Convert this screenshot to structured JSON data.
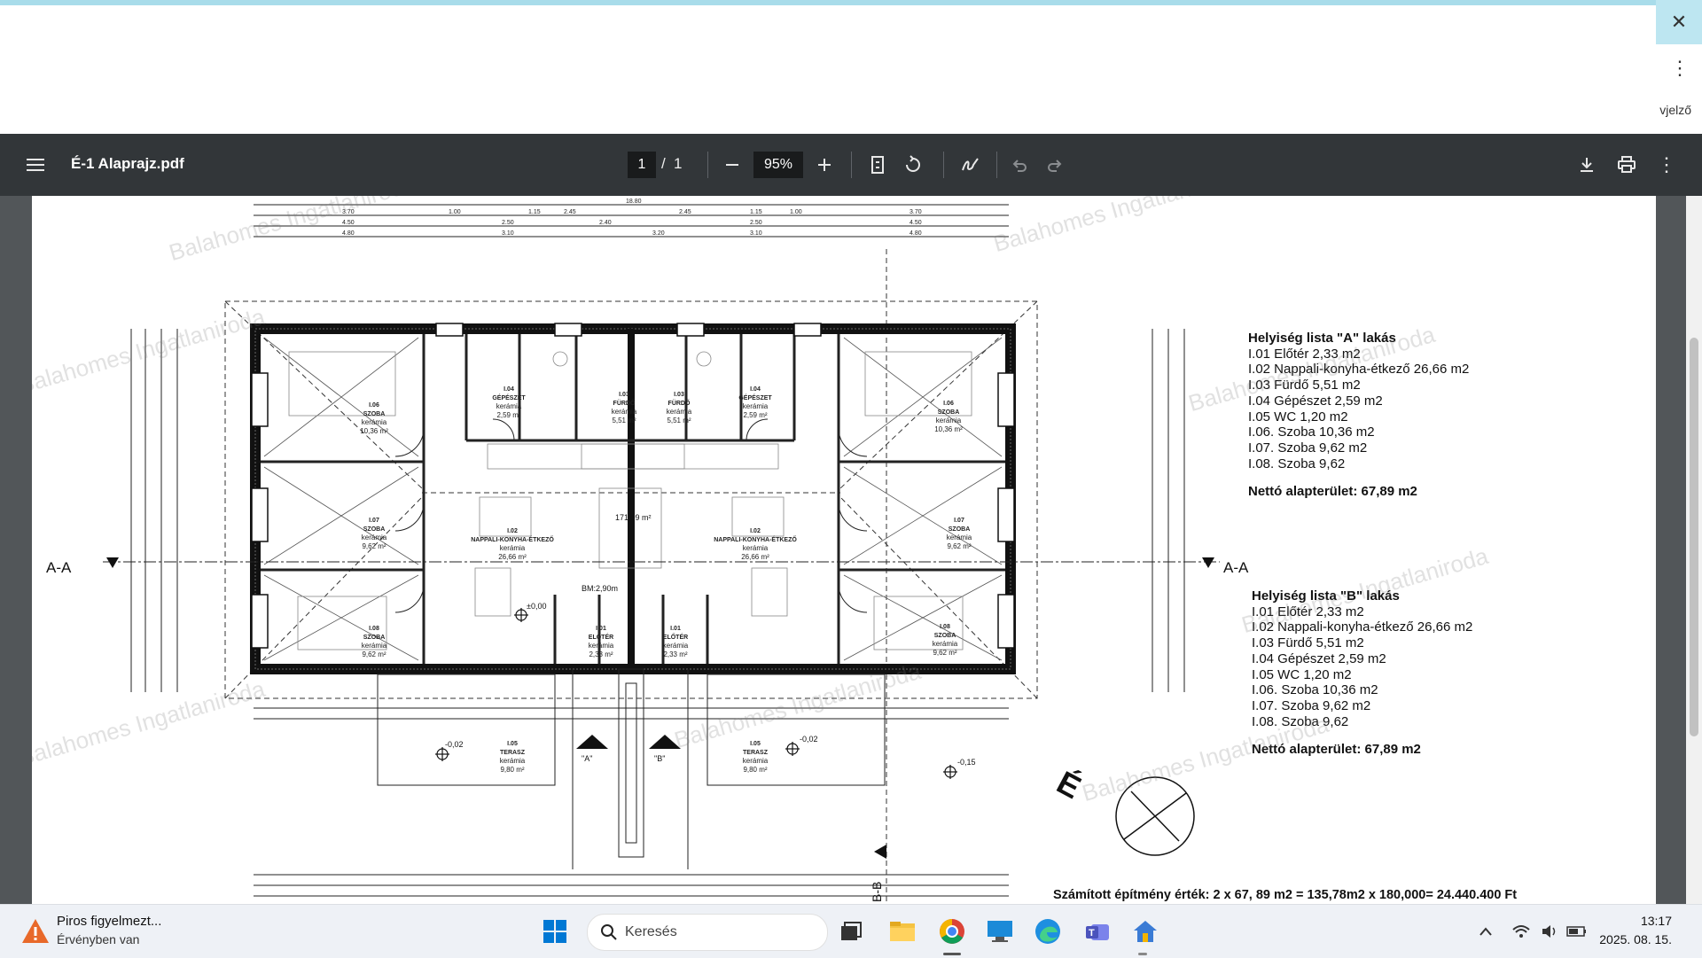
{
  "browser": {
    "menu_label": "⋮",
    "close_label": "✕",
    "side_text": "vjelző"
  },
  "toolbar": {
    "title": "É-1 Alaprajz.pdf",
    "page_current": "1",
    "page_sep": "/",
    "page_total": "1",
    "zoom": "95%",
    "icons": [
      "menu-icon",
      "zoom-out-icon",
      "zoom-in-icon",
      "fit-page-icon",
      "rotate-icon",
      "draw-icon",
      "undo-icon",
      "redo-icon",
      "download-icon",
      "print-icon",
      "more-icon"
    ]
  },
  "drawing": {
    "section_left": "A-A",
    "section_right": "A-A",
    "section_bottom": "B-B",
    "north_label": "É",
    "center_label": "BM:2,90m",
    "level_0": "±0,00",
    "level_1": "-0,02",
    "level_2": "-0,02",
    "level_3": "-0,15",
    "entry_a": "\"A\"",
    "entry_b": "\"B\"",
    "area_center": "171,09 m²",
    "rooms": [
      {
        "code": "I.06",
        "name": "SZOBA",
        "mat": "kerámia",
        "area": "10,36 m²"
      },
      {
        "code": "I.07",
        "name": "SZOBA",
        "mat": "kerámia",
        "area": "9,62 m²"
      },
      {
        "code": "I.08",
        "name": "SZOBA",
        "mat": "kerámia",
        "area": "9,62 m²"
      },
      {
        "code": "I.02",
        "name": "NAPPALI-KONYHA-ÉTKEZŐ",
        "mat": "kerámia",
        "area": "26,66 m²"
      },
      {
        "code": "I.02",
        "name": "NAPPALI-KONYHA-ÉTKEZŐ",
        "mat": "kerámia",
        "area": "26,66 m²"
      },
      {
        "code": "I.06",
        "name": "SZOBA",
        "mat": "kerámia",
        "area": "10,36 m²"
      },
      {
        "code": "I.07",
        "name": "SZOBA",
        "mat": "kerámia",
        "area": "9,62 m²"
      },
      {
        "code": "I.08",
        "name": "SZOBA",
        "mat": "kerámia",
        "area": "9,62 m²"
      },
      {
        "code": "I.03",
        "name": "FÜRDŐ",
        "mat": "kerámia",
        "area": "5,51 m²"
      },
      {
        "code": "I.03",
        "name": "FÜRDŐ",
        "mat": "kerámia",
        "area": "5,51 m²"
      },
      {
        "code": "I.04",
        "name": "GÉPÉSZET",
        "mat": "kerámia",
        "area": "2,59 m²"
      },
      {
        "code": "I.04",
        "name": "GÉPÉSZET",
        "mat": "kerámia",
        "area": "2,59 m²"
      },
      {
        "code": "I.01",
        "name": "ELŐTÉR",
        "mat": "kerámia",
        "area": "2,33 m²"
      },
      {
        "code": "I.01",
        "name": "ELŐTÉR",
        "mat": "kerámia",
        "area": "2,33 m²"
      },
      {
        "code": "I.05",
        "name": "TERASZ",
        "mat": "kerámia",
        "area": "9,80 m²"
      },
      {
        "code": "I.05",
        "name": "TERASZ",
        "mat": "kerámia",
        "area": "9,80 m²"
      }
    ]
  },
  "room_list_a": {
    "heading": "Helyiség lista \"A\" lakás",
    "items": [
      "I.01 Előtér 2,33 m2",
      "I.02 Nappali-konyha-étkező 26,66 m2",
      "I.03 Fürdő 5,51 m2",
      "I.04 Gépészet 2,59 m2",
      "I.05 WC 1,20 m2",
      "I.06. Szoba 10,36 m2",
      "I.07. Szoba 9,62 m2",
      "I.08. Szoba 9,62"
    ],
    "net": "Nettó alapterület: 67,89 m2"
  },
  "room_list_b": {
    "heading": "Helyiség lista \"B\" lakás",
    "items": [
      "I.01 Előtér 2,33 m2",
      "I.02 Nappali-konyha-étkező 26,66 m2",
      "I.03 Fürdő 5,51 m2",
      "I.04 Gépészet 2,59 m2",
      "I.05 WC 1,20 m2",
      "I.06. Szoba 10,36 m2",
      "I.07. Szoba 9,62 m2",
      "I.08. Szoba 9,62"
    ],
    "net": "Nettó alapterület: 67,89 m2"
  },
  "cost_line": "Számított építmény érték: 2 x 67, 89 m2 = 135,78m2 x 180,000= 24.440.400 Ft",
  "watermark": "Balahomes Ingatlaniroda",
  "taskbar": {
    "notif_title": "Piros figyelmezt...",
    "notif_sub": "Érvényben van",
    "search_placeholder": "Keresés",
    "time": "13:17",
    "date": "2025. 08. 15."
  }
}
